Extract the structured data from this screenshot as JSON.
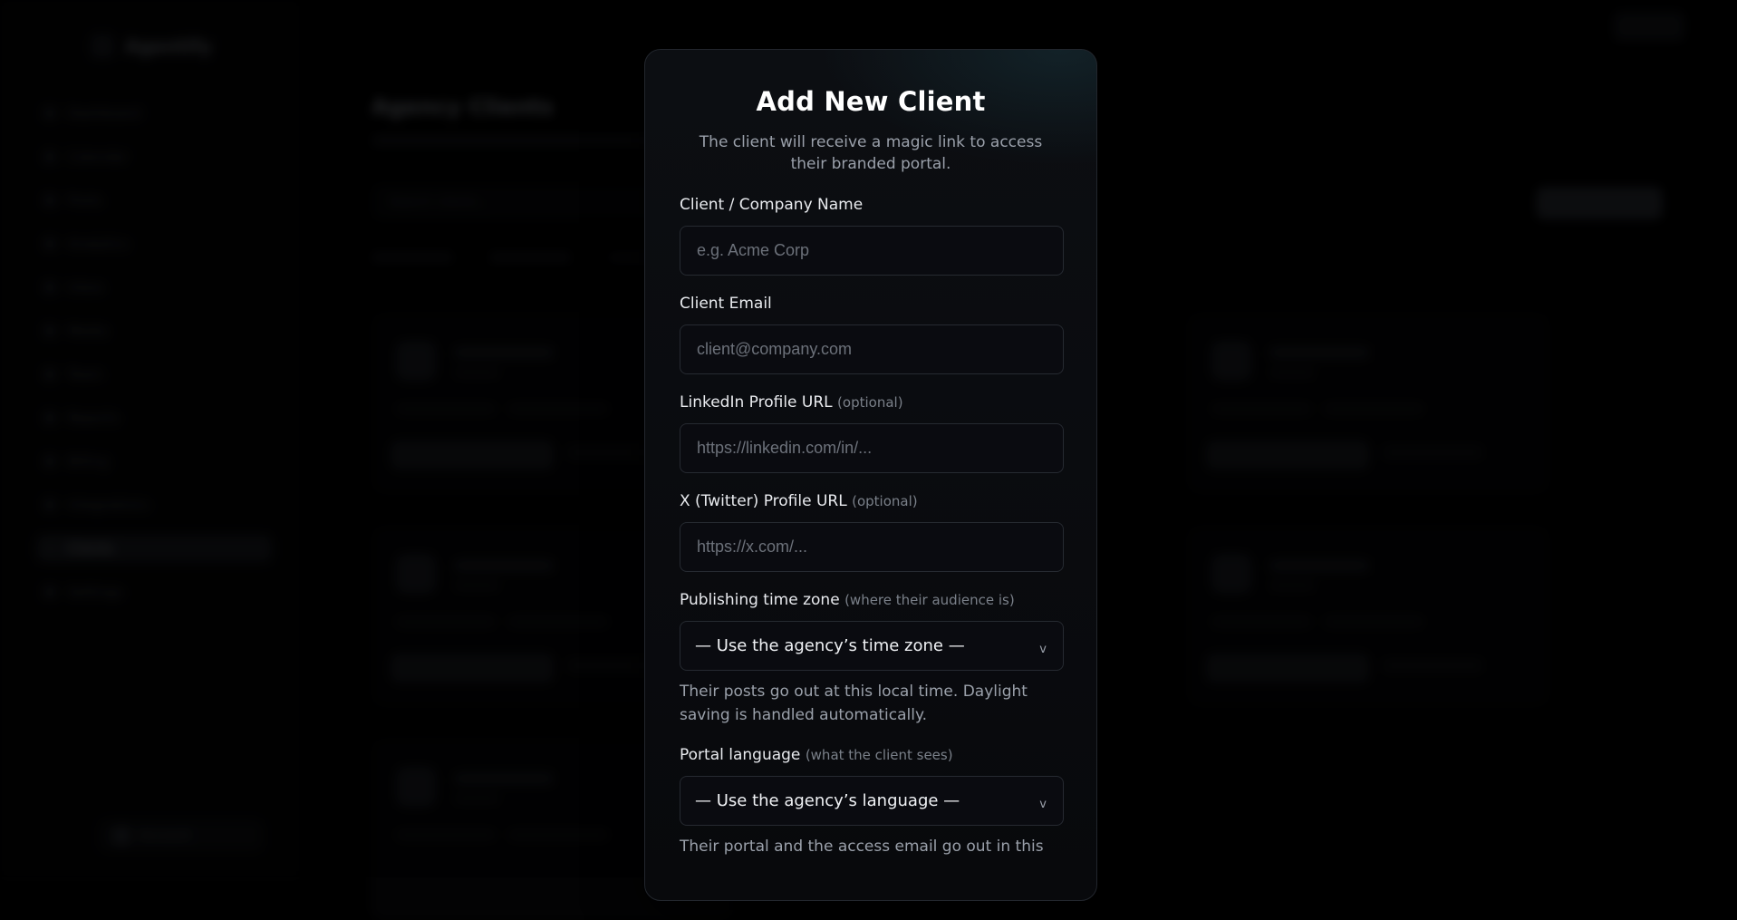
{
  "background": {
    "brand": "Agentify",
    "nav_items": [
      "Dashboard",
      "Calendar",
      "Posts",
      "Analytics",
      "Inbox",
      "Media",
      "Team",
      "Reports",
      "Billing",
      "Integrations",
      "Clients",
      "Settings"
    ],
    "active_nav_index": 10,
    "page_title": "Agency Clients",
    "search_placeholder": "Search clients...",
    "user_label": "Account"
  },
  "modal": {
    "title": "Add New Client",
    "subtitle": "The client will receive a magic link to access their branded portal.",
    "fields": {
      "name": {
        "label": "Client / Company Name",
        "placeholder": "e.g. Acme Corp"
      },
      "email": {
        "label": "Client Email",
        "placeholder": "client@company.com"
      },
      "linkedin": {
        "label": "LinkedIn Profile URL",
        "hint": "(optional)",
        "placeholder": "https://linkedin.com/in/..."
      },
      "twitter": {
        "label": "X (Twitter) Profile URL",
        "hint": "(optional)",
        "placeholder": "https://x.com/..."
      },
      "timezone": {
        "label": "Publishing time zone",
        "hint": "(where their audience is)",
        "selected": "— Use the agency’s time zone —",
        "help": "Their posts go out at this local time. Daylight saving is handled automatically."
      },
      "language": {
        "label": "Portal language",
        "hint": "(what the client sees)",
        "selected": "— Use the agency’s language —",
        "help": "Their portal and the access email go out in this"
      }
    },
    "chevron_glyph": "v"
  },
  "colors": {
    "background": "#000000",
    "modal_bg": "#0a0b0f",
    "input_bg": "#0a0b10",
    "input_border": "#262a31",
    "text_primary": "#ffffff",
    "text_muted": "#9aa0aa"
  }
}
